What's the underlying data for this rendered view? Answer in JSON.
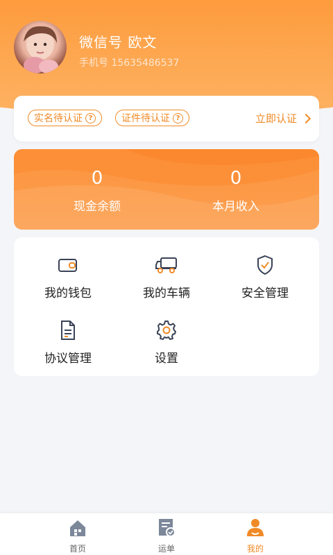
{
  "profile": {
    "name": "微信号  欧文",
    "phone": "手机号 15635486537"
  },
  "auth": {
    "tags": [
      {
        "label": "实名待认证",
        "icon": "question-circle-icon"
      },
      {
        "label": "证件待认证",
        "icon": "question-circle-icon"
      }
    ],
    "q_mark": "?",
    "verify_label": "立即认证"
  },
  "stats": {
    "cash_balance_value": "0",
    "cash_balance_label": "现金余额",
    "month_income_value": "0",
    "month_income_label": "本月收入"
  },
  "menu": {
    "items": [
      {
        "label": "我的钱包",
        "icon": "wallet-icon"
      },
      {
        "label": "我的车辆",
        "icon": "truck-icon"
      },
      {
        "label": "安全管理",
        "icon": "shield-check-icon"
      },
      {
        "label": "协议管理",
        "icon": "document-icon"
      },
      {
        "label": "设置",
        "icon": "gear-icon"
      }
    ]
  },
  "tabbar": {
    "items": [
      {
        "label": "首页",
        "icon": "home-icon",
        "active": false
      },
      {
        "label": "运单",
        "icon": "waybill-icon",
        "active": false
      },
      {
        "label": "我的",
        "icon": "user-icon",
        "active": true
      }
    ]
  },
  "colors": {
    "accent": "#f08a26",
    "header": "#fe8f2a",
    "icon_dark": "#3a4256",
    "tab_inactive": "#7c879a"
  }
}
